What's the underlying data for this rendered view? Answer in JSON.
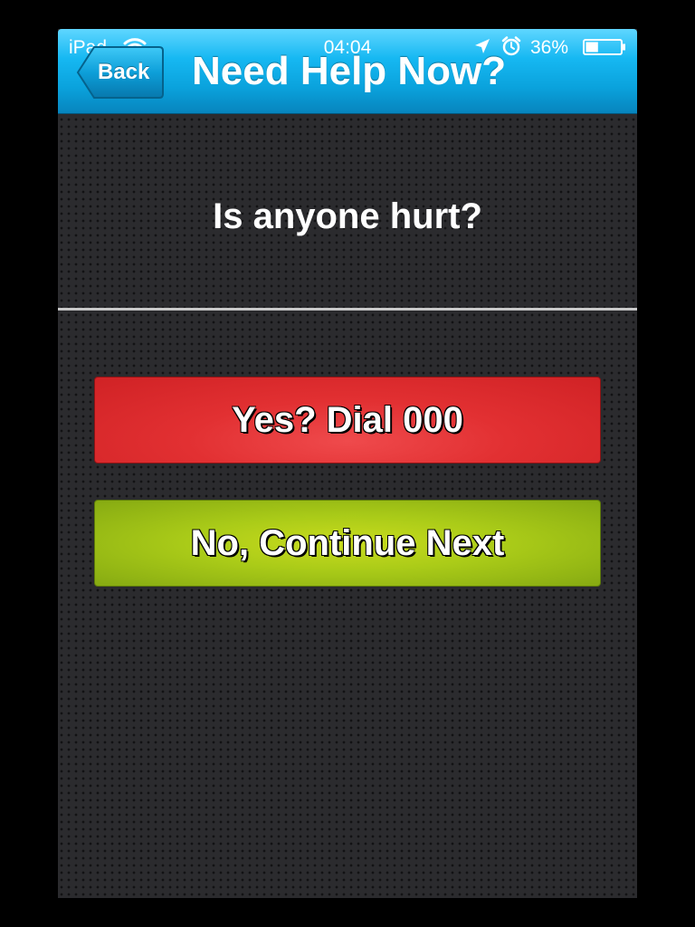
{
  "status_bar": {
    "carrier": "iPad",
    "time": "04:04",
    "battery_percent": "36%",
    "battery_level": 0.36,
    "icons": [
      "wifi-icon",
      "location-icon",
      "alarm-icon",
      "battery-icon"
    ]
  },
  "navbar": {
    "back_label": "Back",
    "title": "Need Help Now?"
  },
  "main": {
    "question": "Is anyone hurt?",
    "yes_button_label": "Yes? Dial 000",
    "no_button_label": "No, Continue Next"
  },
  "colors": {
    "navbar_accent": "#0aa2dc",
    "yes_button": "#e23032",
    "no_button": "#aacb18",
    "background": "#2b2b2e"
  }
}
